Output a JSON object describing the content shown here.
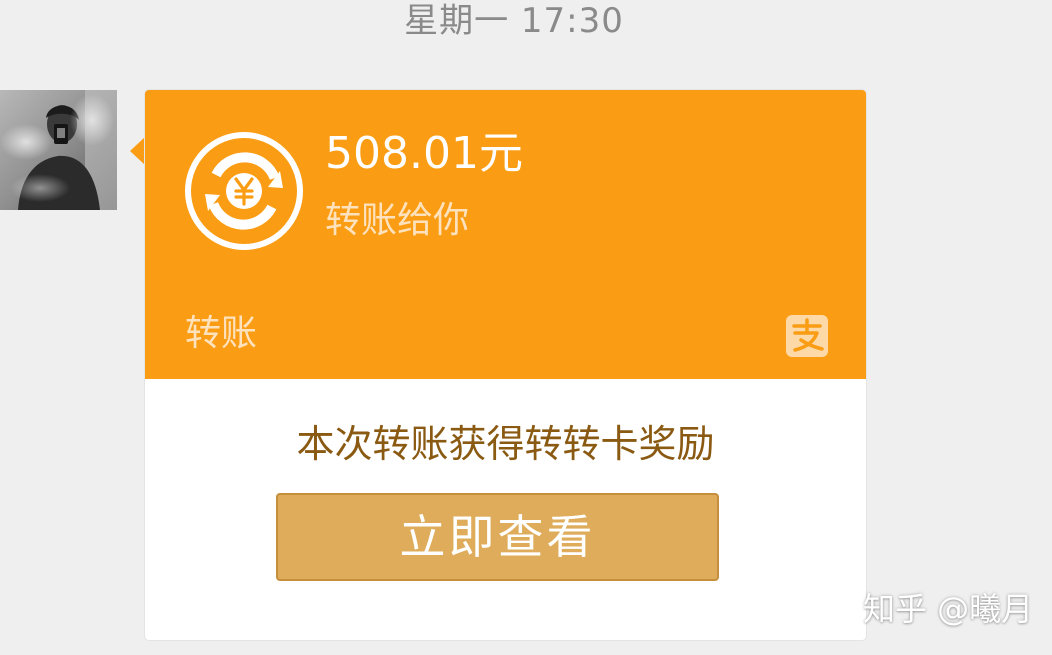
{
  "chat": {
    "timestamp": "星期一 17:30"
  },
  "transfer_card": {
    "amount": "508.01元",
    "subtitle": "转账给你",
    "type_label": "转账",
    "icon": "transfer-yuan-icon",
    "provider_icon": "alipay-icon",
    "reward_text": "本次转账获得转转卡奖励",
    "button_label": "立即查看",
    "colors": {
      "header": "#fa9d14",
      "button": "#deac5b",
      "reward_text": "#8a5a12"
    }
  },
  "watermark": {
    "text": "知乎 @曦月"
  }
}
